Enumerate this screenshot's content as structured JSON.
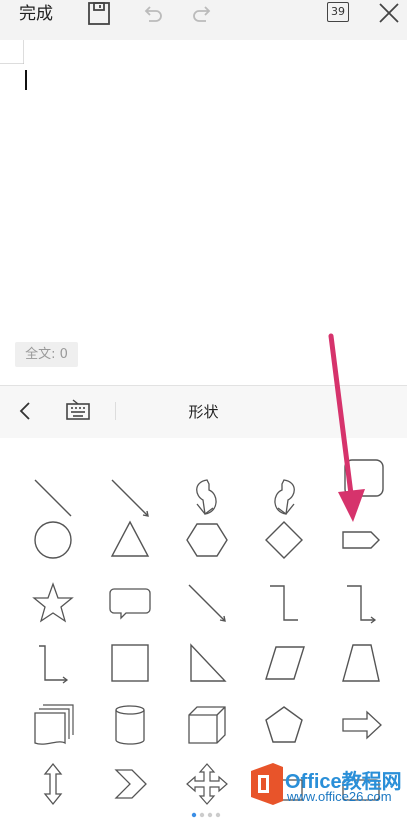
{
  "toolbar": {
    "done_label": "完成",
    "page_count": "39",
    "icons": [
      "save-icon",
      "undo-icon",
      "redo-icon",
      "page-count-icon",
      "close-icon"
    ]
  },
  "editor": {
    "word_count": "全文: 0"
  },
  "shape_panel": {
    "title": "形状",
    "back_icon": "chevron-left-icon",
    "keyboard_icon": "keyboard-icon",
    "shapes": [
      "line",
      "arrow-line",
      "curved-arrow-left",
      "curved-arrow-right",
      "rounded-rectangle",
      "circle",
      "triangle",
      "hexagon",
      "diamond",
      "pentagon-arrow",
      "star",
      "speech-bubble",
      "arrow-line-2",
      "elbow-connector",
      "elbow-arrow-connector",
      "elbow-connector-2",
      "square",
      "right-triangle",
      "parallelogram",
      "trapezoid",
      "multi-document",
      "cylinder",
      "cube",
      "pentagon",
      "block-arrow-right",
      "up-down-arrow",
      "chevron",
      "four-way-arrow",
      "shape-pencil-overlay",
      "shape-last"
    ]
  },
  "watermark": {
    "brand": "Office教程网",
    "url": "www.office26.com"
  },
  "colors": {
    "annotation_arrow": "#d6336c",
    "watermark_orange": "#e8542a",
    "watermark_blue": "#2a8fd8"
  }
}
